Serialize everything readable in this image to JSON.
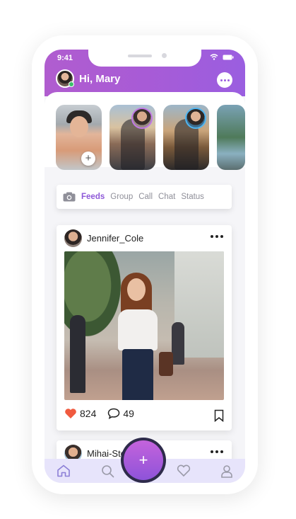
{
  "status_bar": {
    "time": "9:41"
  },
  "header": {
    "greeting": "Hi, Mary"
  },
  "stories": [
    {
      "kind": "own",
      "add_label": "+"
    },
    {
      "kind": "friend"
    },
    {
      "kind": "friend"
    },
    {
      "kind": "friend"
    }
  ],
  "tabs": [
    "Feeds",
    "Group",
    "Call",
    "Chat",
    "Status"
  ],
  "active_tab": "Feeds",
  "posts": [
    {
      "author": "Jennifer_Cole",
      "likes": "824",
      "comments": "49"
    },
    {
      "author": "Mihai-Ste"
    }
  ],
  "fab_label": "+",
  "nav": [
    "home-icon",
    "search-icon",
    "heart-icon",
    "profile-icon"
  ],
  "colors": {
    "accent": "#9b5de0",
    "header_gradient_start": "#b05dcf",
    "nav_bg": "#e7e4fb",
    "like": "#f05a3f"
  }
}
